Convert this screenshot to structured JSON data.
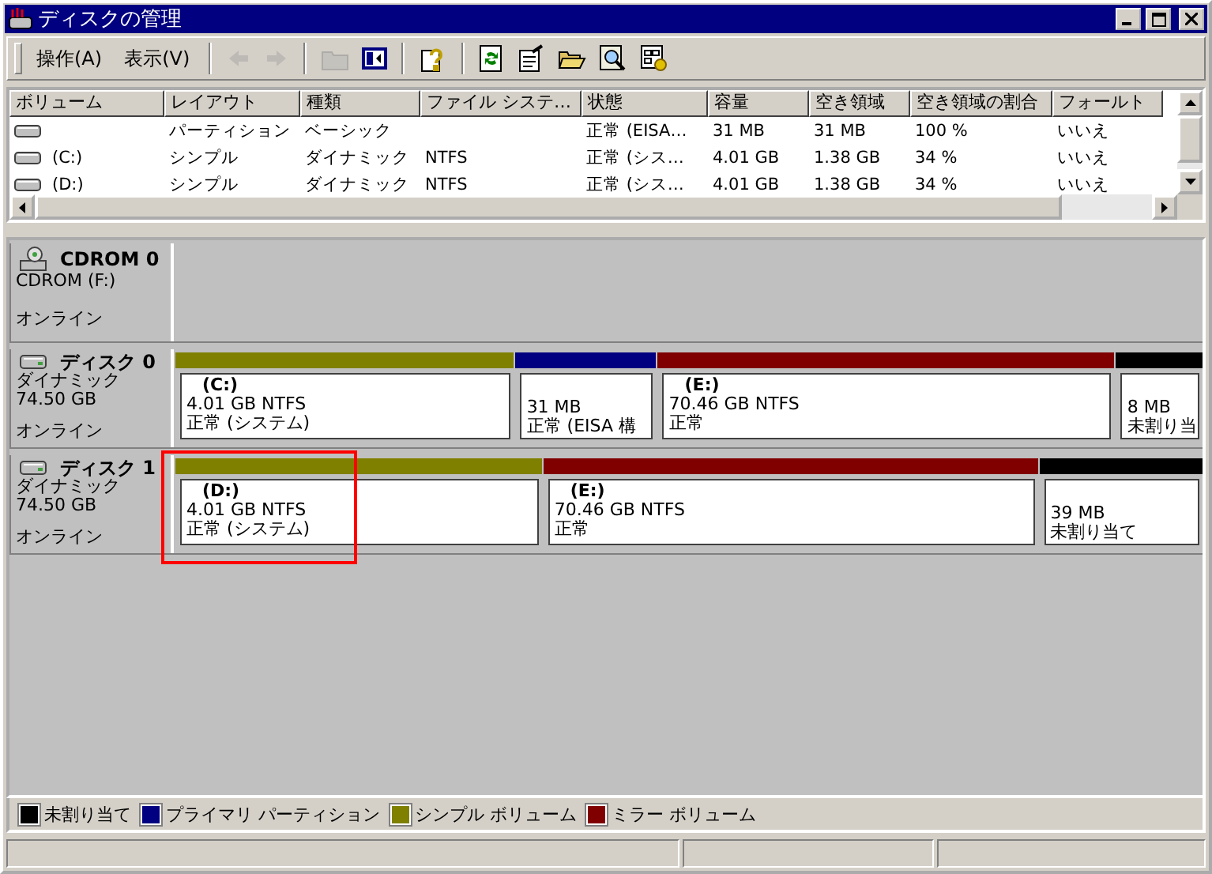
{
  "window": {
    "title": "ディスクの管理"
  },
  "menu": [
    "操作(A)",
    "表示(V)"
  ],
  "toolbar": [
    {
      "kind": "back",
      "disabled": true
    },
    {
      "kind": "forward",
      "disabled": true
    },
    {
      "kind": "sep"
    },
    {
      "kind": "up",
      "disabled": true
    },
    {
      "kind": "pane",
      "disabled": false
    },
    {
      "kind": "sep"
    },
    {
      "kind": "help",
      "disabled": false
    },
    {
      "kind": "sep"
    },
    {
      "kind": "refresh",
      "disabled": false
    },
    {
      "kind": "properties",
      "disabled": false
    },
    {
      "kind": "open",
      "disabled": false
    },
    {
      "kind": "search",
      "disabled": false
    },
    {
      "kind": "settings",
      "disabled": false
    }
  ],
  "table": {
    "columns": [
      "ボリューム",
      "レイアウト",
      "種類",
      "ファイル システ…",
      "状態",
      "容量",
      "空き領域",
      "空き領域の割合",
      "フォールト"
    ],
    "rows": [
      [
        "",
        "パーティション",
        "ベーシック",
        "",
        "正常 (EISA…",
        "31 MB",
        "31 MB",
        "100 %",
        "いいえ"
      ],
      [
        "(C:)",
        "シンプル",
        "ダイナミック",
        "NTFS",
        "正常 (シス…",
        "4.01 GB",
        "1.38 GB",
        "34 %",
        "いいえ"
      ],
      [
        "(D:)",
        "シンプル",
        "ダイナミック",
        "NTFS",
        "正常 (シス…",
        "4.01 GB",
        "1.38 GB",
        "34 %",
        "いいえ"
      ]
    ]
  },
  "disks": [
    {
      "kind": "cdrom",
      "name": "CDROM 0",
      "lines": [
        "CDROM (F:)"
      ],
      "status": "オンライン"
    },
    {
      "kind": "disk",
      "name": "ディスク 0",
      "lines": [
        "ダイナミック",
        "74.50 GB"
      ],
      "status": "オンライン",
      "partitions": [
        {
          "label": "(C:)",
          "size": "4.01 GB NTFS",
          "status": "正常 (システム)",
          "color": "#808000"
        },
        {
          "size": "31 MB",
          "status": "正常 (EISA 構",
          "color": "#000080"
        },
        {
          "label": "(E:)",
          "size": "70.46 GB NTFS",
          "status": "正常",
          "color": "#800000"
        },
        {
          "size": "8 MB",
          "status": "未割り当",
          "color": "#000000"
        }
      ]
    },
    {
      "kind": "disk",
      "name": "ディスク 1",
      "lines": [
        "ダイナミック",
        "74.50 GB"
      ],
      "status": "オンライン",
      "partitions": [
        {
          "label": "(D:)",
          "size": "4.01 GB NTFS",
          "status": "正常 (システム)",
          "color": "#808000"
        },
        {
          "label": "(E:)",
          "size": "70.46 GB NTFS",
          "status": "正常",
          "color": "#800000"
        },
        {
          "size": "39 MB",
          "status": "未割り当て",
          "color": "#000000"
        }
      ]
    }
  ],
  "legend": [
    {
      "label": "未割り当て",
      "color": "#000000"
    },
    {
      "label": "プライマリ パーティション",
      "color": "#000080"
    },
    {
      "label": "シンプル ボリューム",
      "color": "#808000"
    },
    {
      "label": "ミラー ボリューム",
      "color": "#800000"
    }
  ]
}
